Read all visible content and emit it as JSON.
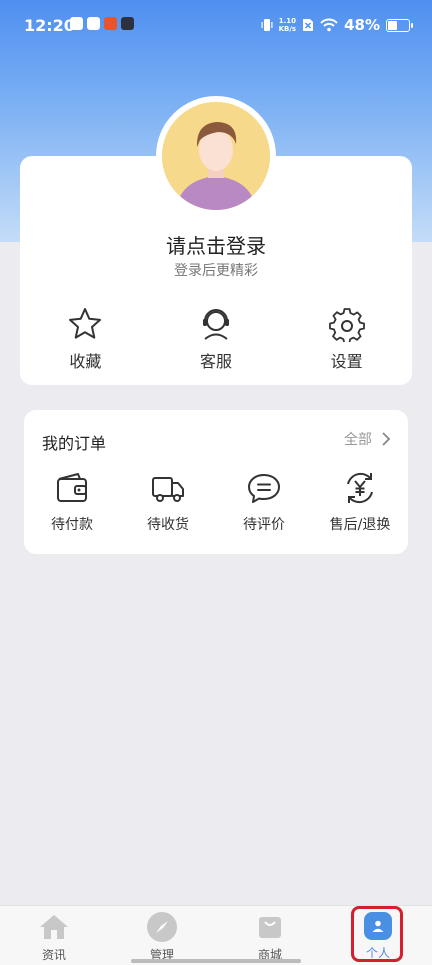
{
  "status_bar": {
    "time": "12:20",
    "net_speed_value": "1.10",
    "net_speed_unit": "KB/s",
    "battery_text": "48%",
    "battery_level": 0.48
  },
  "profile": {
    "title": "请点击登录",
    "subtitle": "登录后更精彩",
    "quick_actions": [
      {
        "label": "收藏",
        "icon": "star-icon"
      },
      {
        "label": "客服",
        "icon": "headset-icon"
      },
      {
        "label": "设置",
        "icon": "gear-icon"
      }
    ]
  },
  "orders": {
    "title": "我的订单",
    "all_label": "全部",
    "items": [
      {
        "label": "待付款",
        "icon": "wallet-icon"
      },
      {
        "label": "待收货",
        "icon": "truck-icon"
      },
      {
        "label": "待评价",
        "icon": "chat-icon"
      },
      {
        "label": "售后/退换",
        "icon": "yuan-refresh-icon"
      }
    ]
  },
  "tabbar": {
    "items": [
      {
        "label": "资讯",
        "icon": "home-icon"
      },
      {
        "label": "管理",
        "icon": "compass-icon"
      },
      {
        "label": "商城",
        "icon": "shopping-bag-icon"
      },
      {
        "label": "个人",
        "icon": "user-icon",
        "active": true
      }
    ]
  },
  "colors": {
    "accent": "#4a90e2",
    "highlight_box": "#d4202e"
  }
}
